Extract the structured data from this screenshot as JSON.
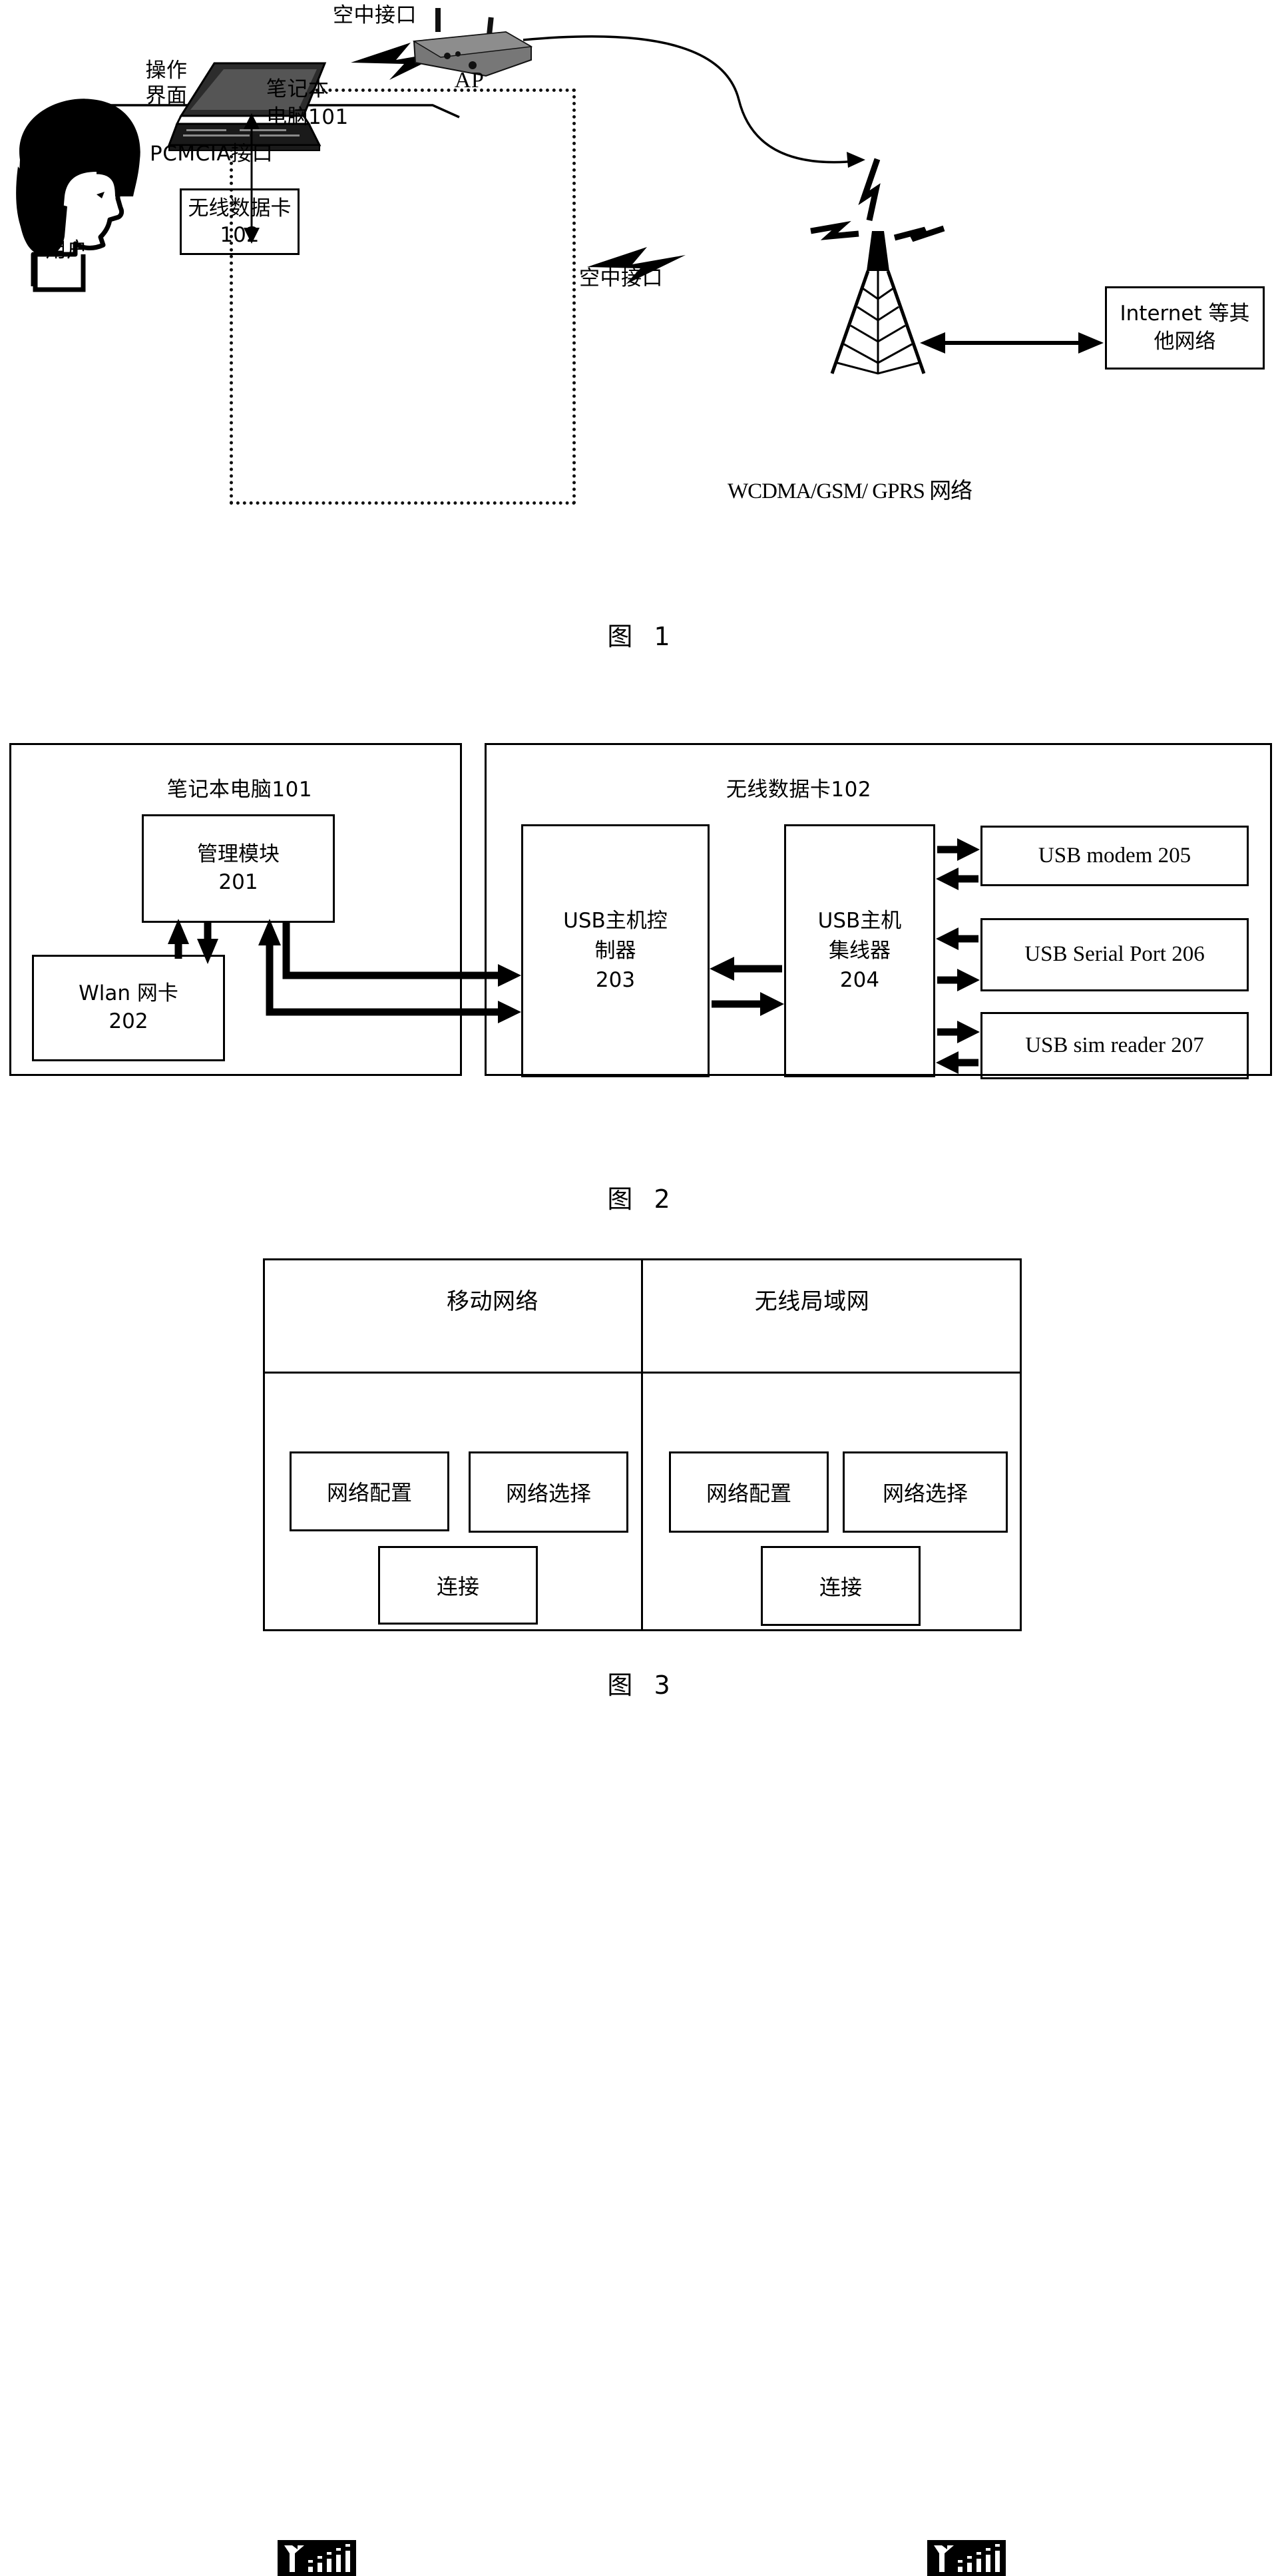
{
  "figure1": {
    "caption": "图 1",
    "labels": {
      "operation_interface": "操作\n界面",
      "user": "用户",
      "laptop": "笔记本\n电脑101",
      "pcmcia": "PCMCIA接口",
      "air_interface_top": "空中接口",
      "air_interface_bottom": "空中接口",
      "ap": "AP",
      "wcdma_network": "WCDMA/GSM/ GPRS 网络"
    },
    "boxes": {
      "wireless_data_card": "无线数据卡\n102",
      "internet": "Internet 等其\n他网络"
    }
  },
  "figure2": {
    "caption": "图 2",
    "left_panel_title": "笔记本电脑101",
    "right_panel_title": "无线数据卡102",
    "boxes": {
      "management_module": "管理模块\n201",
      "wlan_card": "Wlan 网卡\n202",
      "usb_host_controller": "USB主机控\n制器\n203",
      "usb_host_hub": "USB主机\n集线器\n204",
      "usb_modem": "USB modem   205",
      "usb_serial_port": "USB Serial Port  206",
      "usb_sim_reader": "USB sim reader  207"
    }
  },
  "figure3": {
    "caption": "图 3",
    "left_column": {
      "title": "移动网络",
      "buttons": {
        "network_config": "网络配置",
        "network_select": "网络选择",
        "connect": "连接"
      }
    },
    "right_column": {
      "title": "无线局域网",
      "buttons": {
        "network_config": "网络配置",
        "network_select": "网络选择",
        "connect": "连接"
      }
    }
  }
}
